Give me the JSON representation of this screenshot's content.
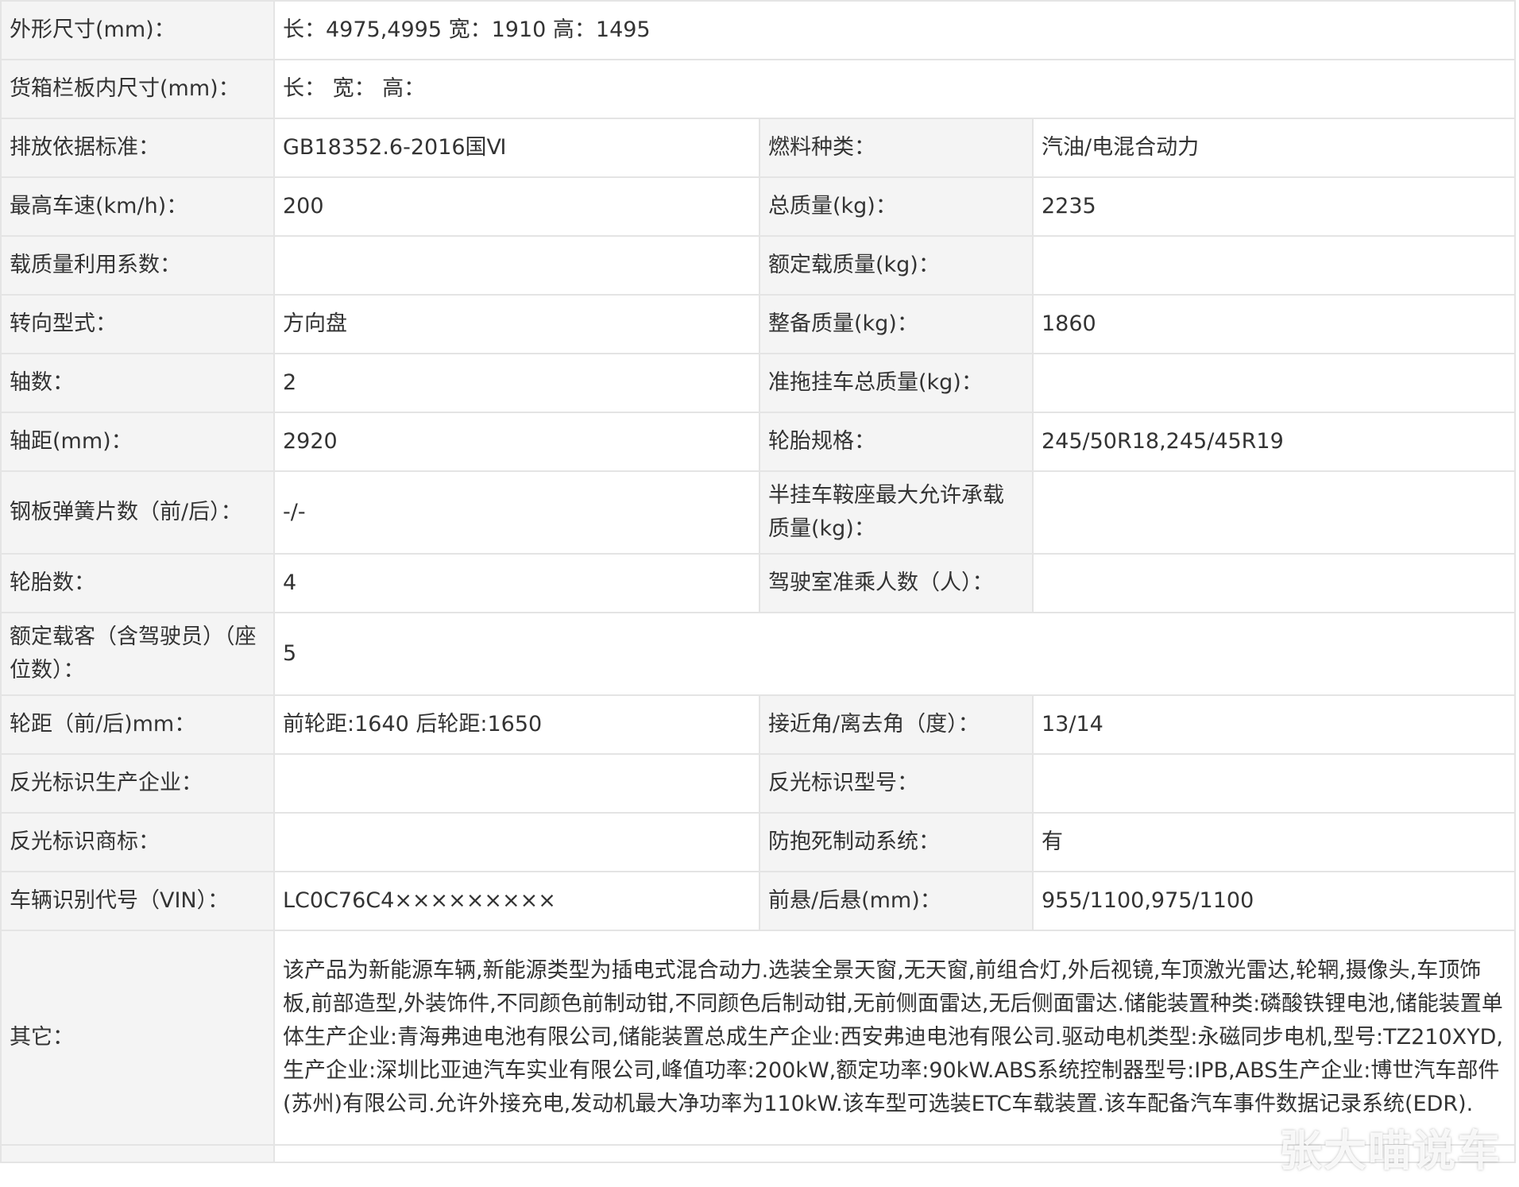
{
  "rows": {
    "dimensions": {
      "label": "外形尺寸(mm)：",
      "value": "长：4975,4995 宽：1910 高：1495"
    },
    "cargo_box": {
      "label": "货箱栏板内尺寸(mm)：",
      "value": "长： 宽： 高："
    },
    "emission": {
      "label": "排放依据标准：",
      "value": "GB18352.6-2016国Ⅵ",
      "label2": "燃料种类：",
      "value2": "汽油/电混合动力"
    },
    "top_speed": {
      "label": "最高车速(km/h)：",
      "value": "200",
      "label2": "总质量(kg)：",
      "value2": "2235"
    },
    "load_factor": {
      "label": "载质量利用系数：",
      "value": "",
      "label2": "额定载质量(kg)：",
      "value2": ""
    },
    "steering": {
      "label": "转向型式：",
      "value": "方向盘",
      "label2": "整备质量(kg)：",
      "value2": "1860"
    },
    "axles": {
      "label": "轴数：",
      "value": "2",
      "label2": "准拖挂车总质量(kg)：",
      "value2": ""
    },
    "wheelbase": {
      "label": "轴距(mm)：",
      "value": "2920",
      "label2": "轮胎规格：",
      "value2": "245/50R18,245/45R19"
    },
    "leaf_springs": {
      "label": "钢板弹簧片数（前/后）：",
      "value": "-/-",
      "label2": "半挂车鞍座最大允许承载质量(kg)：",
      "value2": ""
    },
    "tires": {
      "label": "轮胎数：",
      "value": "4",
      "label2": "驾驶室准乘人数（人）：",
      "value2": ""
    },
    "passengers": {
      "label": "额定载客（含驾驶员）（座位数）：",
      "value": "5"
    },
    "track": {
      "label": "轮距（前/后)mm：",
      "value": "前轮距:1640 后轮距:1650",
      "label2": "接近角/离去角（度）：",
      "value2": "13/14"
    },
    "reflector_maker": {
      "label": "反光标识生产企业：",
      "value": "",
      "label2": "反光标识型号：",
      "value2": ""
    },
    "reflector_brand": {
      "label": "反光标识商标：",
      "value": "",
      "label2": "防抱死制动系统：",
      "value2": "有"
    },
    "vin": {
      "label": "车辆识别代号（VIN）：",
      "value": "LC0C76C4×××××××××",
      "label2": "前悬/后悬(mm)：",
      "value2": "955/1100,975/1100"
    },
    "other": {
      "label": "其它：",
      "value": "该产品为新能源车辆,新能源类型为插电式混合动力.选装全景天窗,无天窗,前组合灯,外后视镜,车顶激光雷达,轮辋,摄像头,车顶饰板,前部造型,外装饰件,不同颜色前制动钳,不同颜色后制动钳,无前侧面雷达,无后侧面雷达.储能装置种类:磷酸铁锂电池,储能装置单体生产企业:青海弗迪电池有限公司,储能装置总成生产企业:西安弗迪电池有限公司.驱动电机类型:永磁同步电机,型号:TZ210XYD,生产企业:深圳比亚迪汽车实业有限公司,峰值功率:200kW,额定功率:90kW.ABS系统控制器型号:IPB,ABS生产企业:博世汽车部件(苏州)有限公司.允许外接充电,发动机最大净功率为110kW.该车型可选装ETC车载装置.该车配备汽车事件数据记录系统(EDR)."
    }
  },
  "watermark": "张大喵说车"
}
